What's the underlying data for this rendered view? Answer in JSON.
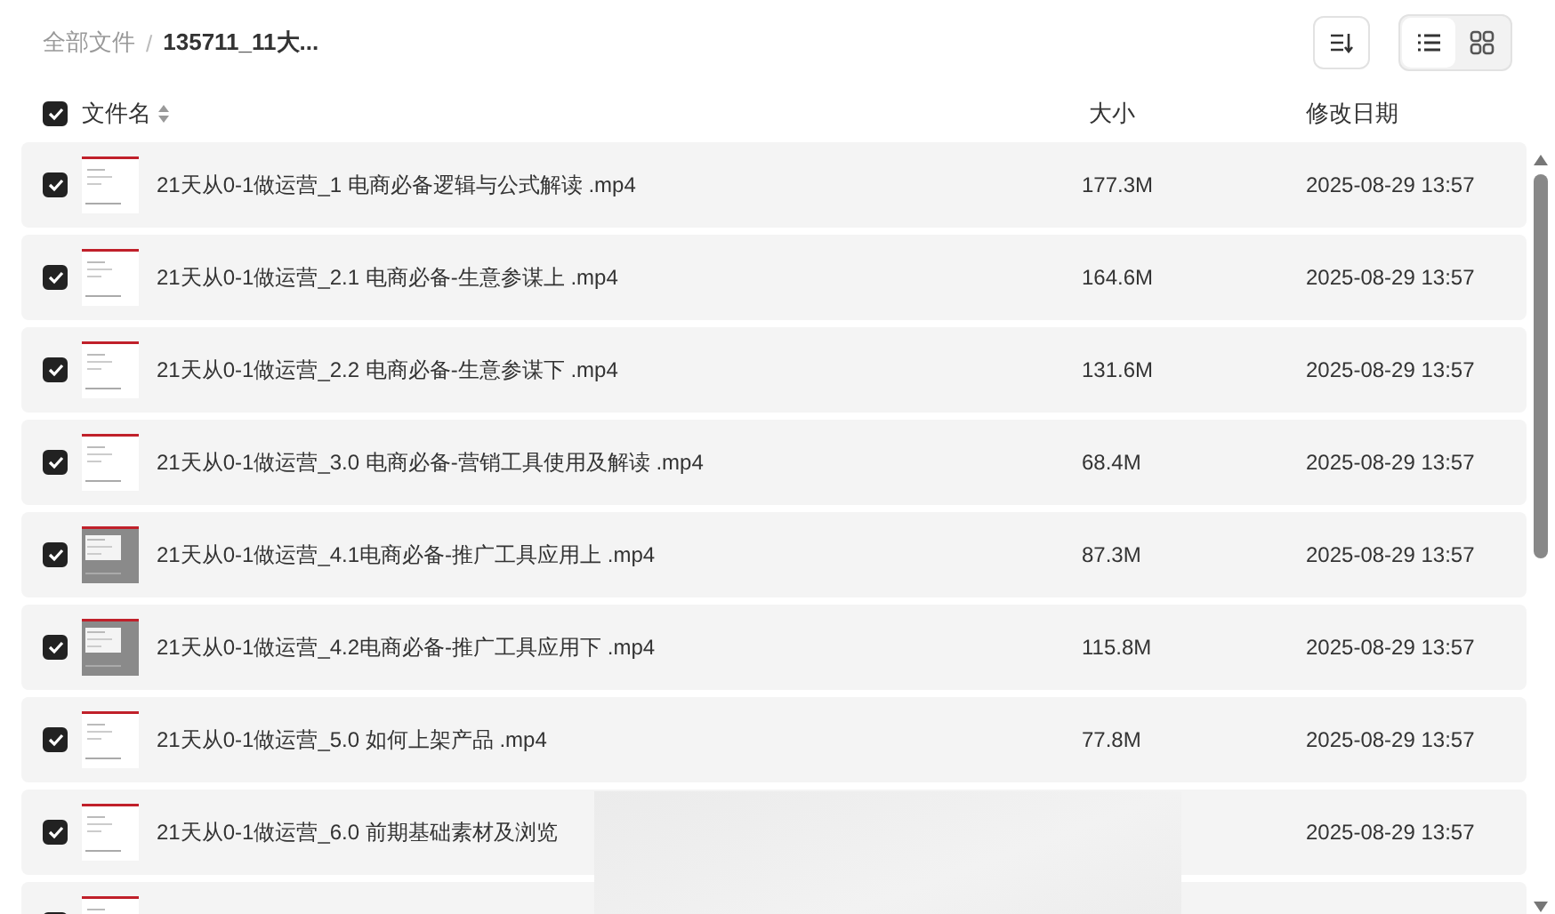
{
  "breadcrumb_separator": "/",
  "breadcrumb": [
    {
      "label": "全部文件",
      "current": false
    },
    {
      "label": "135711_11大...",
      "current": true
    }
  ],
  "view_modes": [
    {
      "kind": "list",
      "selected": true
    },
    {
      "kind": "grid",
      "selected": false
    }
  ],
  "table": {
    "select_all": {
      "checked": true
    },
    "columns": [
      "文件名",
      "大小",
      "修改日期"
    ],
    "rows": [
      {
        "checked": true,
        "name": "21天从0-1做运营_1 电商必备逻辑与公式解读 .mp4",
        "size": "177.3M",
        "date": "2025-08-29 13:57"
      },
      {
        "checked": true,
        "name": "21天从0-1做运营_2.1 电商必备-生意参谋上 .mp4",
        "size": "164.6M",
        "date": "2025-08-29 13:57"
      },
      {
        "checked": true,
        "name": "21天从0-1做运营_2.2 电商必备-生意参谋下 .mp4",
        "size": "131.6M",
        "date": "2025-08-29 13:57"
      },
      {
        "checked": true,
        "name": "21天从0-1做运营_3.0 电商必备-营销工具使用及解读 .mp4",
        "size": "68.4M",
        "date": "2025-08-29 13:57"
      },
      {
        "checked": true,
        "name": "21天从0-1做运营_4.1电商必备-推广工具应用上 .mp4",
        "size": "87.3M",
        "date": "2025-08-29 13:57"
      },
      {
        "checked": true,
        "name": "21天从0-1做运营_4.2电商必备-推广工具应用下 .mp4",
        "size": "115.8M",
        "date": "2025-08-29 13:57"
      },
      {
        "checked": true,
        "name": "21天从0-1做运营_5.0 如何上架产品 .mp4",
        "size": "77.8M",
        "date": "2025-08-29 13:57"
      },
      {
        "checked": true,
        "name": "21天从0-1做运营_6.0 前期基础素材及浏览",
        "date": "2025-08-29 13:57"
      },
      {
        "checked": true
      }
    ]
  }
}
